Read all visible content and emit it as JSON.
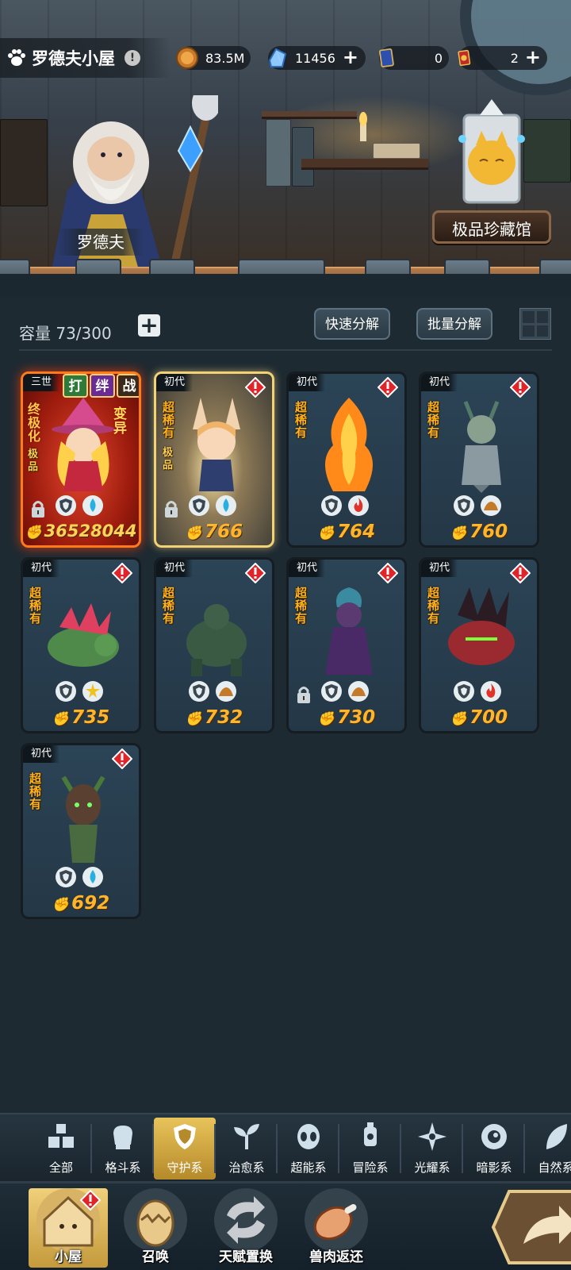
{
  "header": {
    "title": "罗德夫小屋",
    "resources": [
      {
        "icon": "gold-coin-icon",
        "value": "83.5M",
        "has_plus": false
      },
      {
        "icon": "crystal-icon",
        "value": "11456",
        "has_plus": true
      },
      {
        "icon": "blue-card-icon",
        "value": "0",
        "has_plus": false
      },
      {
        "icon": "gold-card-icon",
        "value": "2",
        "has_plus": true
      }
    ]
  },
  "scene": {
    "character_name": "罗德夫",
    "museum_button": "极品珍藏馆"
  },
  "storage": {
    "capacity_label": "容量",
    "capacity_value": "73/300",
    "quick_decompose": "快速分解",
    "batch_decompose": "批量分解"
  },
  "pets": [
    {
      "gen": "三世",
      "rarity": "终极化",
      "sub": "极品",
      "power": "36528044",
      "type": "guardian",
      "element": "water",
      "locked": true,
      "alert": false,
      "frame": "red",
      "bonds": [
        "打",
        "绊",
        "战"
      ],
      "mutation": "变异"
    },
    {
      "gen": "初代",
      "rarity": "超稀有",
      "sub": "极品",
      "power": "766",
      "type": "guardian",
      "element": "water",
      "locked": true,
      "alert": true,
      "frame": "gold"
    },
    {
      "gen": "初代",
      "rarity": "超稀有",
      "sub": "",
      "power": "764",
      "type": "guardian",
      "element": "fire",
      "locked": false,
      "alert": true,
      "frame": "normal"
    },
    {
      "gen": "初代",
      "rarity": "超稀有",
      "sub": "",
      "power": "760",
      "type": "guardian",
      "element": "earth",
      "locked": false,
      "alert": true,
      "frame": "normal"
    },
    {
      "gen": "初代",
      "rarity": "超稀有",
      "sub": "",
      "power": "735",
      "type": "guardian",
      "element": "light",
      "locked": false,
      "alert": true,
      "frame": "normal"
    },
    {
      "gen": "初代",
      "rarity": "超稀有",
      "sub": "",
      "power": "732",
      "type": "guardian",
      "element": "earth",
      "locked": false,
      "alert": true,
      "frame": "normal"
    },
    {
      "gen": "初代",
      "rarity": "超稀有",
      "sub": "",
      "power": "730",
      "type": "guardian",
      "element": "earth",
      "locked": true,
      "alert": true,
      "frame": "normal"
    },
    {
      "gen": "初代",
      "rarity": "超稀有",
      "sub": "",
      "power": "700",
      "type": "guardian",
      "element": "fire",
      "locked": false,
      "alert": true,
      "frame": "normal"
    },
    {
      "gen": "初代",
      "rarity": "超稀有",
      "sub": "",
      "power": "692",
      "type": "guardian",
      "element": "water",
      "locked": false,
      "alert": true,
      "frame": "normal"
    }
  ],
  "categories": [
    {
      "label": "全部",
      "icon": "all-blocks-icon",
      "active": false
    },
    {
      "label": "格斗系",
      "icon": "fist-icon",
      "active": false
    },
    {
      "label": "守护系",
      "icon": "shield-icon",
      "active": true
    },
    {
      "label": "治愈系",
      "icon": "sprout-icon",
      "active": false
    },
    {
      "label": "超能系",
      "icon": "alien-icon",
      "active": false
    },
    {
      "label": "冒险系",
      "icon": "lantern-icon",
      "active": false
    },
    {
      "label": "光耀系",
      "icon": "compass-star-icon",
      "active": false
    },
    {
      "label": "暗影系",
      "icon": "eye-icon",
      "active": false
    },
    {
      "label": "自然系",
      "icon": "leaf-icon",
      "active": false
    }
  ],
  "nav": [
    {
      "label": "小屋",
      "icon": "house-icon",
      "active": true,
      "alert": true
    },
    {
      "label": "召唤",
      "icon": "egg-icon",
      "active": false,
      "alert": false
    },
    {
      "label": "天赋置换",
      "icon": "swap-arrows-icon",
      "active": false,
      "alert": false
    },
    {
      "label": "兽肉返还",
      "icon": "meat-icon",
      "active": false,
      "alert": false
    }
  ],
  "colors": {
    "accent_gold": "#f0c24a",
    "power_orange": "#ffb52b",
    "alert_red": "#e0242a",
    "panel_bg": "#1e2a32"
  }
}
